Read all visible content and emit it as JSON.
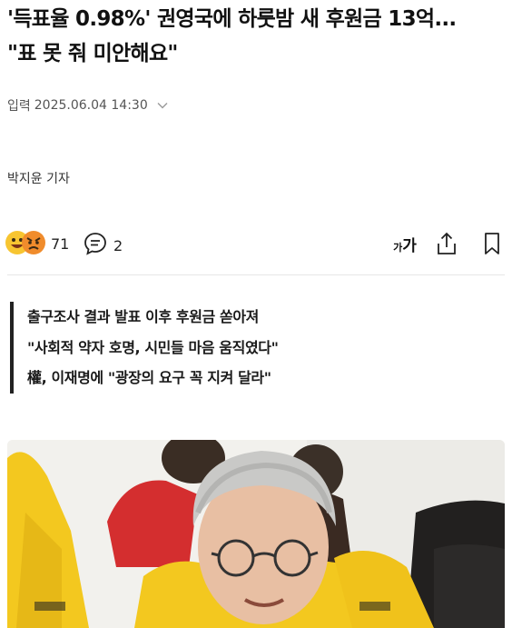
{
  "article": {
    "headline_line1": "'득표율 0.98%' 권영국에 하룻밤 새 후원금 13억...",
    "headline_line2": "\"표 못 줘 미안해요\"",
    "published_label": "입력",
    "published_datetime": "2025.06.04 14:30",
    "reporter": "박지윤 기자",
    "subheadings": [
      "출구조사 결과 발표 이후 후원금 쏟아져",
      "\"사회적 약자 호명, 시민들 마음 움직였다\"",
      "權, 이재명에 \"광장의 요구 꼭 지켜 달라\""
    ]
  },
  "actions": {
    "reaction_count": "71",
    "comment_count": "2",
    "font_size_small": "가",
    "font_size_large": "가",
    "reaction_icons": [
      "smile-emoji-icon",
      "angry-emoji-icon"
    ],
    "comment_icon": "comment-bubble-icon",
    "share_icon": "share-icon",
    "bookmark_icon": "bookmark-icon"
  },
  "photo": {
    "description_icon": "photo"
  },
  "colors": {
    "text": "#111111",
    "muted": "#555555",
    "divider": "#e6e6e6",
    "vest_yellow": "#f3c81f",
    "vest_red": "#d42e2f"
  }
}
